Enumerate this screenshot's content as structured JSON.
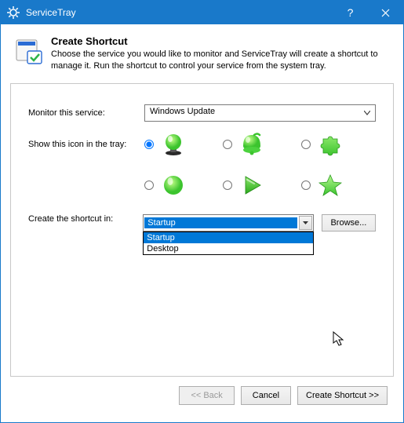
{
  "window": {
    "title": "ServiceTray"
  },
  "header": {
    "title": "Create Shortcut",
    "description": "Choose the service you would like to monitor and ServiceTray will create a shortcut to manage it. Run the shortcut to control your service from the system tray."
  },
  "form": {
    "service_label": "Monitor this service:",
    "service_value": "Windows Update",
    "icon_label": "Show this icon in the tray:",
    "location_label": "Create the shortcut in:",
    "location_selected": "Startup",
    "location_options": [
      "Startup",
      "Desktop"
    ],
    "browse_label": "Browse..."
  },
  "icons": {
    "i0": "lamp-icon",
    "i1": "bell-icon",
    "i2": "puzzle-icon",
    "i3": "circle-icon",
    "i4": "play-icon",
    "i5": "star-icon"
  },
  "buttons": {
    "back": "<< Back",
    "cancel": "Cancel",
    "create": "Create Shortcut >>"
  }
}
